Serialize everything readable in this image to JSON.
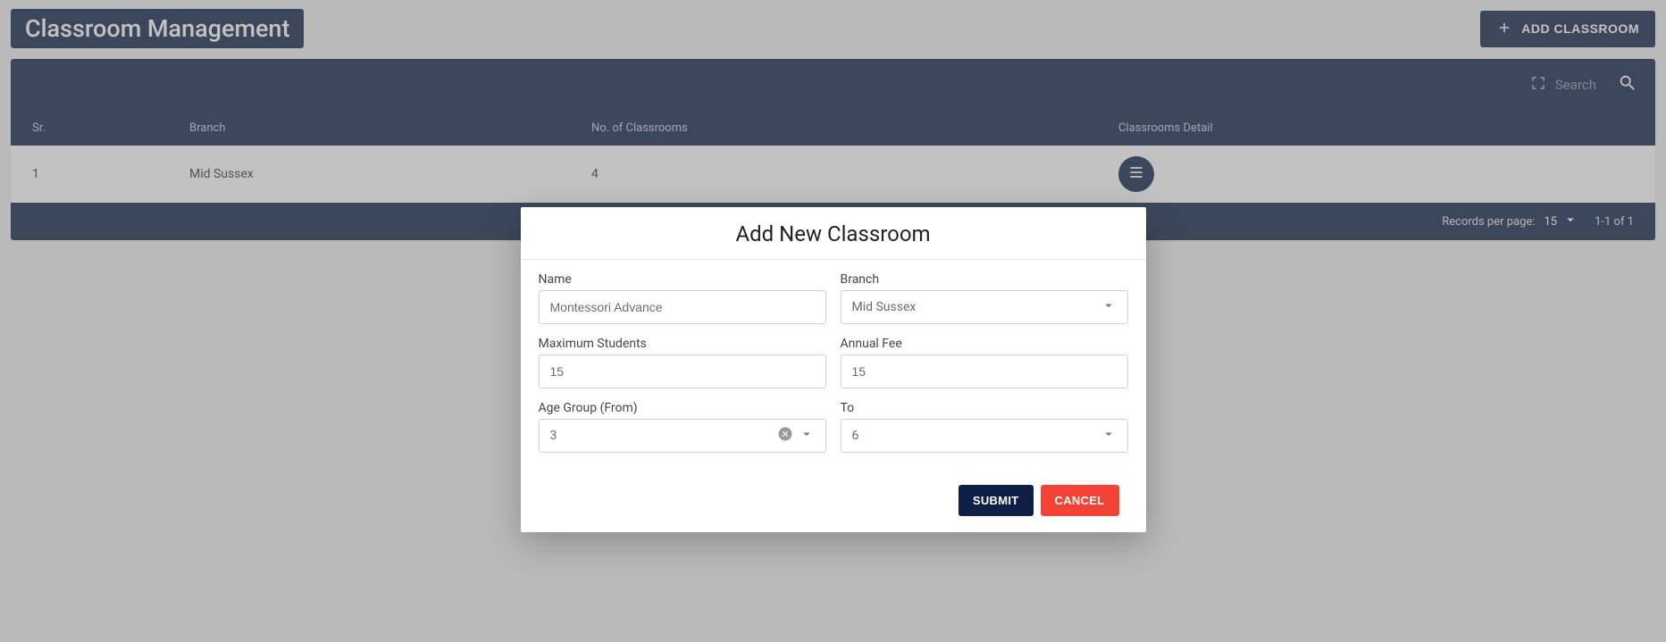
{
  "header": {
    "title": "Classroom Management",
    "add_button": "ADD CLASSROOM"
  },
  "toolbar": {
    "search_placeholder": "Search"
  },
  "table": {
    "columns": {
      "sr": "Sr.",
      "branch": "Branch",
      "count": "No. of Classrooms",
      "detail": "Classrooms Detail"
    },
    "rows": [
      {
        "sr": "1",
        "branch": "Mid Sussex",
        "count": "4"
      }
    ]
  },
  "footer": {
    "per_page_label": "Records per page:",
    "per_page_value": "15",
    "range": "1-1 of 1"
  },
  "modal": {
    "title": "Add New Classroom",
    "fields": {
      "name_label": "Name",
      "name_value": "Montessori Advance",
      "branch_label": "Branch",
      "branch_value": "Mid Sussex",
      "max_label": "Maximum Students",
      "max_value": "15",
      "fee_label": "Annual Fee",
      "fee_value": "15",
      "age_from_label": "Age Group (From)",
      "age_from_value": "3",
      "age_to_label": "To",
      "age_to_value": "6"
    },
    "actions": {
      "submit": "SUBMIT",
      "cancel": "CANCEL"
    }
  }
}
